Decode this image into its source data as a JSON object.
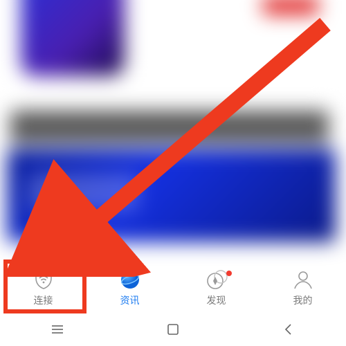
{
  "tabs": [
    {
      "id": "connect",
      "label": "连接",
      "active": false,
      "notif": false,
      "icon": "wifi-shield-icon"
    },
    {
      "id": "news",
      "label": "资讯",
      "active": true,
      "notif": false,
      "icon": "globe-icon"
    },
    {
      "id": "discover",
      "label": "发现",
      "active": false,
      "notif": true,
      "icon": "compass-icon"
    },
    {
      "id": "mine",
      "label": "我的",
      "active": false,
      "notif": false,
      "icon": "profile-icon"
    }
  ],
  "annotation": {
    "highlight_target_tab": "connect",
    "arrow_color": "#ee3a1f"
  },
  "system_nav": {
    "recent": "≡",
    "home": "◻",
    "back": "‹"
  }
}
